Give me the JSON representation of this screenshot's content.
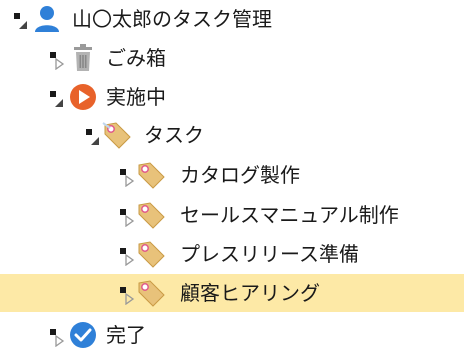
{
  "tree": {
    "root": {
      "label": "山〇太郎のタスク管理",
      "icon": "user-icon",
      "expanded": true,
      "children": {
        "trash": {
          "label": "ごみ箱",
          "icon": "trash-icon",
          "expanded": false
        },
        "in_progress": {
          "label": "実施中",
          "icon": "play-circle-icon",
          "expanded": true,
          "children": {
            "task": {
              "label": "タスク",
              "icon": "tag-icon",
              "expanded": true,
              "children": [
                {
                  "label": "カタログ製作",
                  "icon": "tag-icon",
                  "expanded": false,
                  "selected": false
                },
                {
                  "label": "セールスマニュアル制作",
                  "icon": "tag-icon",
                  "expanded": false,
                  "selected": false
                },
                {
                  "label": "プレスリリース準備",
                  "icon": "tag-icon",
                  "expanded": false,
                  "selected": false
                },
                {
                  "label": "顧客ヒアリング",
                  "icon": "tag-icon",
                  "expanded": false,
                  "selected": true
                }
              ]
            }
          }
        },
        "done": {
          "label": "完了",
          "icon": "check-circle-icon",
          "expanded": false
        }
      }
    }
  },
  "colors": {
    "selection": "#fde9a6",
    "user_icon": "#2f80d8",
    "play_icon": "#e8622a",
    "check_icon": "#2f80d8",
    "tag": "#e8c27a",
    "tag_dot": "#e05a8a"
  }
}
